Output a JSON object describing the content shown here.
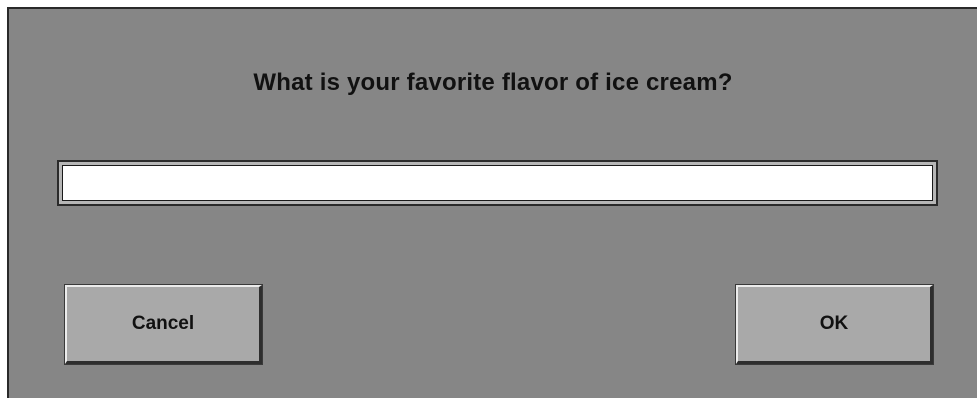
{
  "dialog": {
    "prompt": "What is your favorite flavor of ice cream?",
    "input": {
      "value": "",
      "placeholder": ""
    },
    "buttons": {
      "cancel_label": "Cancel",
      "ok_label": "OK"
    }
  },
  "colors": {
    "dialog_background": "#868686",
    "button_face": "#a9a9a9",
    "input_background": "#ffffff",
    "text": "#111111"
  }
}
